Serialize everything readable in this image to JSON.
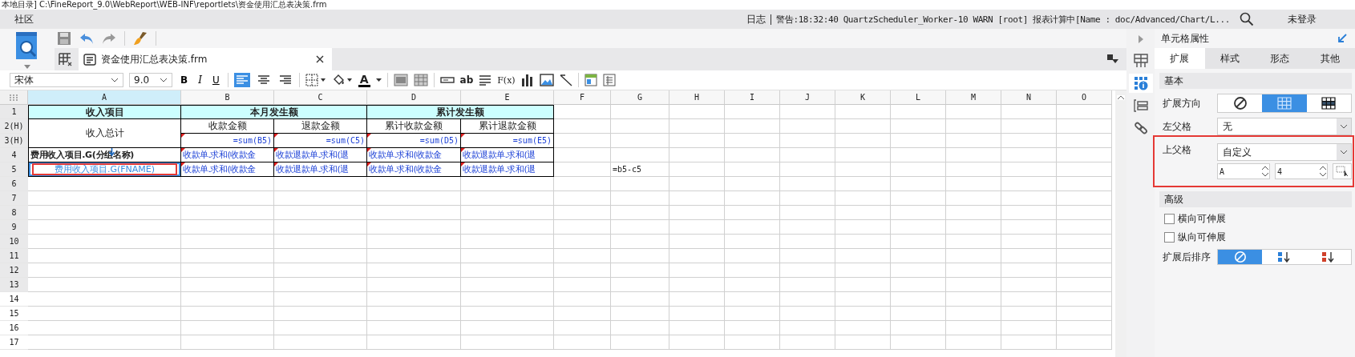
{
  "window": {
    "title": "本地目录]   C:\\FineReport_9.0\\WebReport\\WEB-INF\\reportlets\\资金使用汇总表决策.frm"
  },
  "menu_bar": {
    "left": "社区",
    "log": "日志",
    "message": "警告:18:32:40 QuartzScheduler_Worker-10 WARN [root] 报表计算中[Name : doc/Advanced/Chart/L...",
    "user": "未登录"
  },
  "tabs": [
    {
      "label": "资金使用汇总表决策.frm",
      "selected": true
    }
  ],
  "format_bar": {
    "font": "宋体",
    "size": "9.0",
    "styles": [
      {
        "kind": "bold",
        "label": "B"
      },
      {
        "kind": "italic",
        "label": "I"
      },
      {
        "kind": "underline",
        "label": "U"
      }
    ],
    "align": [
      {
        "kind": "left",
        "selected": true
      },
      {
        "kind": "center",
        "selected": false
      },
      {
        "kind": "right",
        "selected": false
      }
    ],
    "font_color": "A",
    "text_tool": "ab",
    "formula_tool": "F(x)"
  },
  "sheet": {
    "columns": [
      {
        "label": "A",
        "selected": true
      },
      {
        "label": "B",
        "selected": false
      },
      {
        "label": "C",
        "selected": false
      },
      {
        "label": "D",
        "selected": false
      },
      {
        "label": "E",
        "selected": false
      },
      {
        "label": "F",
        "selected": false
      },
      {
        "label": "G",
        "selected": false
      },
      {
        "label": "H",
        "selected": false
      },
      {
        "label": "I",
        "selected": false
      },
      {
        "label": "J",
        "selected": false
      },
      {
        "label": "K",
        "selected": false
      },
      {
        "label": "L",
        "selected": false
      },
      {
        "label": "M",
        "selected": false
      },
      {
        "label": "N",
        "selected": false
      },
      {
        "label": "O",
        "selected": false
      }
    ],
    "rows": [
      {
        "label": "1",
        "shaded": true,
        "cells": [
          {
            "kind": "header",
            "text": "收入项目",
            "selected": false
          },
          {
            "kind": "header",
            "text": "本月发生额",
            "selected": false
          },
          {
            "kind": "merged-left"
          },
          {
            "kind": "header",
            "text": "累计发生额",
            "selected": false
          },
          {
            "kind": "merged-left"
          }
        ]
      },
      {
        "label": "2(H)",
        "shaded": true,
        "cells": [
          {
            "kind": "title",
            "text": "收入总计",
            "selected": false
          },
          {
            "kind": "title",
            "text": "收款金额",
            "selected": false
          },
          {
            "kind": "title",
            "text": "退款金额",
            "selected": false
          },
          {
            "kind": "title",
            "text": "累计收款金额",
            "selected": false
          },
          {
            "kind": "title",
            "text": "累计退款金额",
            "selected": false
          }
        ]
      },
      {
        "label": "3(H)",
        "shaded": true,
        "cells": [
          {
            "kind": "merged-up"
          },
          {
            "kind": "formula",
            "text": "=sum(B5)",
            "selected": false
          },
          {
            "kind": "formula",
            "text": "=sum(C5)",
            "selected": false
          },
          {
            "kind": "formula",
            "text": "=sum(D5)",
            "selected": false
          },
          {
            "kind": "formula",
            "text": "=sum(E5)",
            "selected": false
          }
        ]
      },
      {
        "label": "4",
        "shaded": true,
        "cells": [
          {
            "kind": "group",
            "text": "费用收入项目.G(分组名称)",
            "selected": false,
            "expand_arrow": true
          },
          {
            "kind": "field",
            "text": "收款单.求和(收款金",
            "selected": false
          },
          {
            "kind": "field",
            "text": "收款退款单.求和(退",
            "selected": false
          },
          {
            "kind": "field",
            "text": "收款单.求和(收款金",
            "selected": false
          },
          {
            "kind": "field",
            "text": "收款退款单.求和(退",
            "selected": false
          }
        ]
      },
      {
        "label": "5",
        "shaded": true,
        "cells": [
          {
            "kind": "dataset",
            "text": "费用收入项目.G(FNAME)",
            "selected": true,
            "highlighted": true
          },
          {
            "kind": "field",
            "text": "收款单.求和(收款金",
            "selected": false
          },
          {
            "kind": "field",
            "text": "收款退款单.求和(退",
            "selected": false
          },
          {
            "kind": "field",
            "text": "收款单.求和(收款金",
            "selected": false
          },
          {
            "kind": "field",
            "text": "收款退款单.求和(退",
            "selected": false
          },
          {
            "kind": "empty",
            "selected": false
          },
          {
            "kind": "plain",
            "text": "=b5-c5",
            "selected": false
          }
        ]
      },
      {
        "label": "6",
        "shaded": true
      },
      {
        "label": "7",
        "shaded": true
      },
      {
        "label": "8",
        "shaded": true
      },
      {
        "label": "9",
        "shaded": true
      },
      {
        "label": "10",
        "shaded": true
      },
      {
        "label": "11",
        "shaded": true
      },
      {
        "label": "12",
        "shaded": true
      },
      {
        "label": "13",
        "shaded": true
      },
      {
        "label": "14",
        "shaded": false
      },
      {
        "label": "15",
        "shaded": false
      },
      {
        "label": "16",
        "shaded": false
      },
      {
        "label": "17",
        "shaded": false
      }
    ]
  },
  "side_icons": [
    {
      "kind": "cell-layout",
      "selected": false
    },
    {
      "kind": "cell-attributes",
      "selected": true
    },
    {
      "kind": "widget",
      "selected": false
    },
    {
      "kind": "link",
      "selected": false
    }
  ],
  "panel": {
    "title": "单元格属性",
    "tabs": [
      {
        "label": "扩展",
        "selected": true
      },
      {
        "label": "样式",
        "selected": false
      },
      {
        "label": "形态",
        "selected": false
      },
      {
        "label": "其他",
        "selected": false
      }
    ],
    "basic": {
      "title": "基本",
      "direction_label": "扩展方向",
      "direction_options": [
        {
          "kind": "none",
          "selected": false
        },
        {
          "kind": "vertical",
          "selected": true
        },
        {
          "kind": "horizontal",
          "selected": false
        }
      ],
      "left_parent": {
        "label": "左父格",
        "value": "无"
      },
      "top_parent": {
        "label": "上父格",
        "value": "自定义",
        "column": "A",
        "row": "4",
        "highlighted": true
      }
    },
    "advanced": {
      "title": "高级",
      "options": [
        {
          "label": "横向可伸展",
          "checked": false
        },
        {
          "label": "纵向可伸展",
          "checked": false
        }
      ],
      "sort_label": "扩展后排序",
      "sort_options": [
        {
          "kind": "none",
          "selected": true
        },
        {
          "kind": "ascending",
          "selected": false
        },
        {
          "kind": "descending",
          "selected": false
        }
      ]
    }
  }
}
